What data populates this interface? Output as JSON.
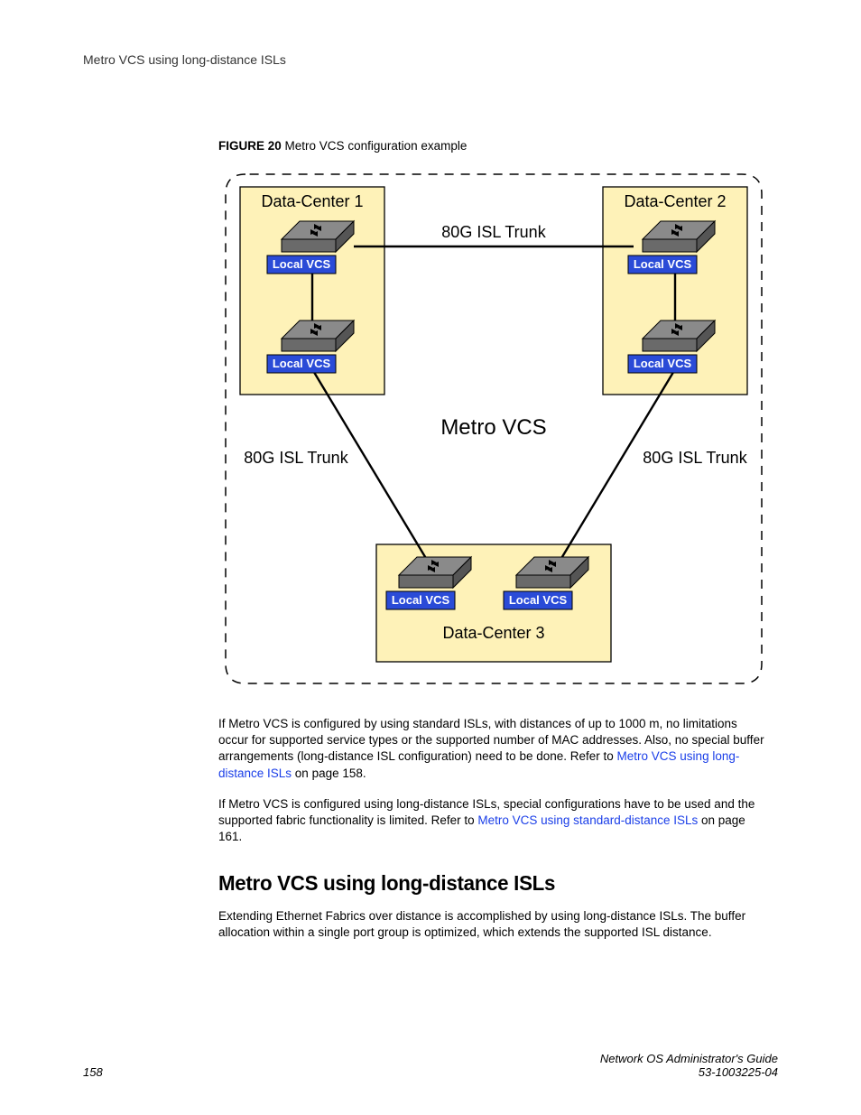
{
  "running_head": "Metro VCS using long-distance ISLs",
  "figure": {
    "label": "FIGURE 20",
    "caption": "Metro VCS configuration example"
  },
  "diagram": {
    "dc1": "Data-Center 1",
    "dc2": "Data-Center 2",
    "dc3": "Data-Center 3",
    "local_vcs": "Local VCS",
    "metro_vcs": "Metro VCS",
    "trunk_top": "80G ISL Trunk",
    "trunk_left": "80G ISL Trunk",
    "trunk_right": "80G ISL Trunk"
  },
  "paragraphs": {
    "p1_a": "If Metro VCS is configured by using standard ISLs, with distances of up to 1000 m, no limitations occur for supported service types or the supported number of MAC addresses. Also, no special buffer arrangements (long-distance ISL configuration) need to be done. Refer to ",
    "p1_link": "Metro VCS using long-distance ISLs",
    "p1_b": " on page 158.",
    "p2_a": "If Metro VCS is configured using long-distance ISLs, special configurations have to be used and the supported fabric functionality is limited. Refer to ",
    "p2_link": "Metro VCS using standard-distance ISLs",
    "p2_b": " on page 161."
  },
  "section_heading": "Metro VCS using long-distance ISLs",
  "section_body": "Extending Ethernet Fabrics over distance is accomplished by using long-distance ISLs. The buffer allocation within a single port group is optimized, which extends the supported ISL distance.",
  "footer": {
    "page_num": "158",
    "guide_title": "Network OS Administrator's Guide",
    "doc_id": "53-1003225-04"
  }
}
